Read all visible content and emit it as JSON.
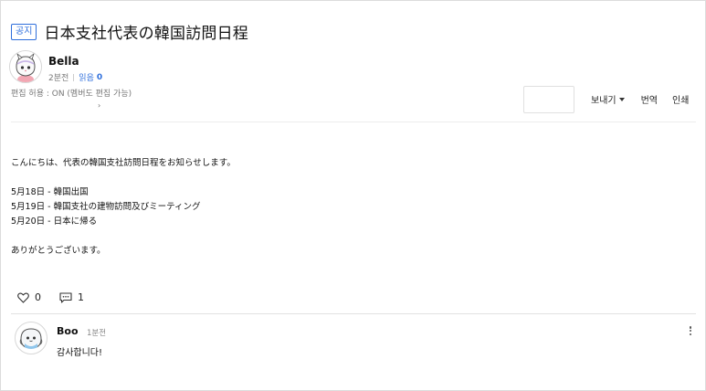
{
  "post": {
    "badge": "공지",
    "title": "日本支社代表の韓国訪問日程",
    "author": "Bella",
    "time_ago": "2분전",
    "read_label": "읽음",
    "read_count": "0",
    "edit_permission": "편집 허용 : ON (멤버도 편집 가능)"
  },
  "toolbar": {
    "send_label": "보내기",
    "translate_label": "번역",
    "print_label": "인쇄"
  },
  "body": {
    "intro": "こんにちは、代表の韓国支社訪問日程をお知らせします。",
    "schedule": [
      "5月18日 - 韓国出国",
      "5月19日 - 韓国支社の建物訪問及びミーティング",
      "5月20日 - 日本に帰る"
    ],
    "closing": "ありがとうございます。"
  },
  "reactions": {
    "like_count": "0",
    "comment_count": "1"
  },
  "comment": {
    "author": "Boo",
    "time_ago": "1분전",
    "text": "감사합니다!"
  },
  "icons": {
    "like": "heart-icon",
    "comment": "comment-icon",
    "more": "more-vertical-icon"
  },
  "colors": {
    "accent": "#2f6fdc"
  }
}
